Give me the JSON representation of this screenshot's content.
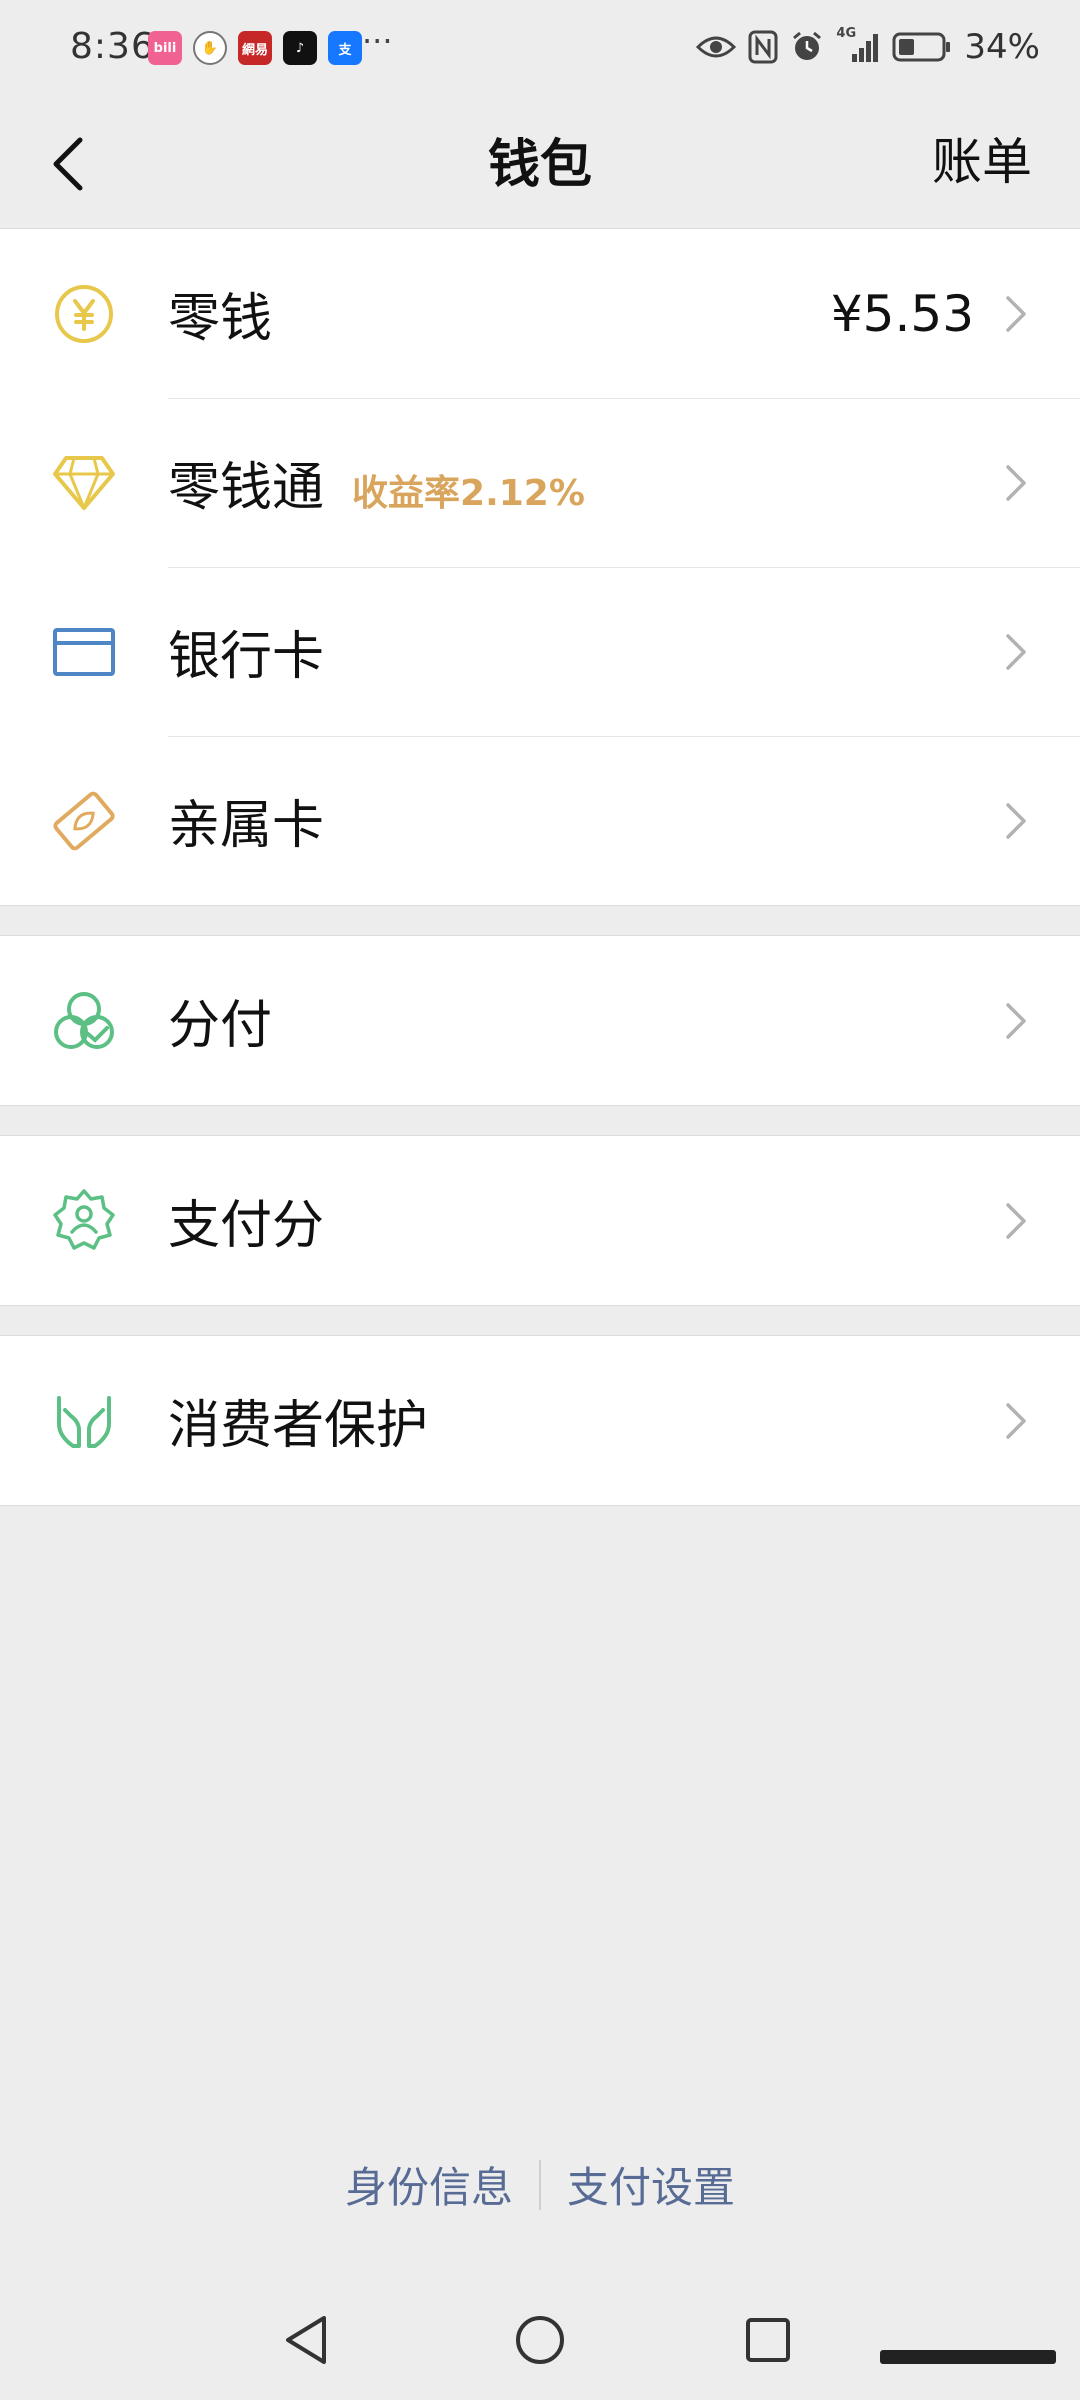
{
  "status": {
    "time": "8:36",
    "more": "···",
    "battery": "34%",
    "signal_label": "4G",
    "apps": [
      {
        "name": "bilibili-app-icon",
        "text": "bili",
        "color": "#f06292"
      },
      {
        "name": "hand-app-icon",
        "text": "✋",
        "color": "#888888"
      },
      {
        "name": "netease-news-app-icon",
        "text": "網易",
        "color": "#c62828"
      },
      {
        "name": "tiktok-app-icon",
        "text": "♪",
        "color": "#111111"
      },
      {
        "name": "alipay-app-icon",
        "text": "支",
        "color": "#1677ff"
      }
    ]
  },
  "nav": {
    "title": "钱包",
    "bill_label": "账单"
  },
  "groups": [
    {
      "rows": [
        {
          "id": "change",
          "label": "零钱",
          "value": "¥5.53",
          "icon": "yuan-coin-icon",
          "color": "#e8c84a"
        },
        {
          "id": "lingqiantong",
          "label": "零钱通",
          "tag": "收益率2.12%",
          "icon": "diamond-icon",
          "color": "#e8c84a"
        },
        {
          "id": "bank-card",
          "label": "银行卡",
          "icon": "bank-card-icon",
          "color": "#4f86c6"
        },
        {
          "id": "family-card",
          "label": "亲属卡",
          "icon": "family-card-icon",
          "color": "#e0aa5f"
        }
      ]
    },
    {
      "rows": [
        {
          "id": "fenfu",
          "label": "分付",
          "icon": "installment-circles-icon",
          "color": "#5cbf84"
        }
      ]
    },
    {
      "rows": [
        {
          "id": "pay-score",
          "label": "支付分",
          "icon": "pay-score-badge-icon",
          "color": "#5cbf84"
        }
      ]
    },
    {
      "rows": [
        {
          "id": "consumer-protection",
          "label": "消费者保护",
          "icon": "protection-hands-icon",
          "color": "#5cbf84"
        }
      ]
    }
  ],
  "footer": {
    "identity": "身份信息",
    "pay_settings": "支付设置"
  },
  "colors": {
    "link": "#576b95",
    "tag": "#d9a55c",
    "background": "#ededed"
  }
}
